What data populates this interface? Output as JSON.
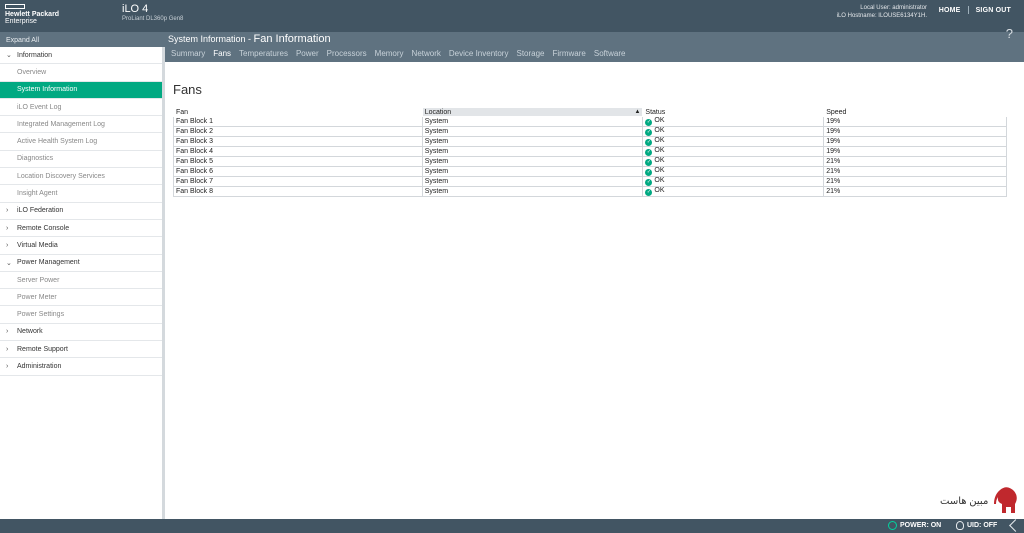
{
  "header": {
    "brand_line1": "Hewlett Packard",
    "brand_line2": "Enterprise",
    "product_name": "iLO 4",
    "product_model": "ProLiant DL360p Gen8",
    "local_user": "Local User: administrator",
    "hostname": "iLO Hostname: ILOUSE6134Y1H.",
    "home_label": "HOME",
    "signout_label": "SIGN OUT"
  },
  "subheader": {
    "expand_all": "Expand All",
    "section": "System Information",
    "separator": " - ",
    "page": "Fan Information",
    "help": "?"
  },
  "tabs": [
    "Summary",
    "Fans",
    "Temperatures",
    "Power",
    "Processors",
    "Memory",
    "Network",
    "Device Inventory",
    "Storage",
    "Firmware",
    "Software"
  ],
  "active_tab": "Fans",
  "sidebar": {
    "items": [
      {
        "label": "Information",
        "type": "section",
        "expanded": true
      },
      {
        "label": "Overview",
        "type": "child"
      },
      {
        "label": "System Information",
        "type": "child",
        "active": true
      },
      {
        "label": "iLO Event Log",
        "type": "child"
      },
      {
        "label": "Integrated Management Log",
        "type": "child"
      },
      {
        "label": "Active Health System Log",
        "type": "child"
      },
      {
        "label": "Diagnostics",
        "type": "child"
      },
      {
        "label": "Location Discovery Services",
        "type": "child"
      },
      {
        "label": "Insight Agent",
        "type": "child"
      },
      {
        "label": "iLO Federation",
        "type": "section",
        "expanded": false
      },
      {
        "label": "Remote Console",
        "type": "section",
        "expanded": false
      },
      {
        "label": "Virtual Media",
        "type": "section",
        "expanded": false
      },
      {
        "label": "Power Management",
        "type": "section",
        "expanded": true
      },
      {
        "label": "Server Power",
        "type": "child"
      },
      {
        "label": "Power Meter",
        "type": "child"
      },
      {
        "label": "Power Settings",
        "type": "child"
      },
      {
        "label": "Network",
        "type": "section",
        "expanded": false
      },
      {
        "label": "Remote Support",
        "type": "section",
        "expanded": false
      },
      {
        "label": "Administration",
        "type": "section",
        "expanded": false
      }
    ]
  },
  "content": {
    "title": "Fans",
    "columns": [
      "Fan",
      "Location",
      "Status",
      "Speed"
    ],
    "sorted_column": "Location",
    "rows": [
      {
        "fan": "Fan Block 1",
        "location": "System",
        "status": "OK",
        "speed": "19%"
      },
      {
        "fan": "Fan Block 2",
        "location": "System",
        "status": "OK",
        "speed": "19%"
      },
      {
        "fan": "Fan Block 3",
        "location": "System",
        "status": "OK",
        "speed": "19%"
      },
      {
        "fan": "Fan Block 4",
        "location": "System",
        "status": "OK",
        "speed": "19%"
      },
      {
        "fan": "Fan Block 5",
        "location": "System",
        "status": "OK",
        "speed": "21%"
      },
      {
        "fan": "Fan Block 6",
        "location": "System",
        "status": "OK",
        "speed": "21%"
      },
      {
        "fan": "Fan Block 7",
        "location": "System",
        "status": "OK",
        "speed": "21%"
      },
      {
        "fan": "Fan Block 8",
        "location": "System",
        "status": "OK",
        "speed": "21%"
      }
    ]
  },
  "footer": {
    "power": "POWER: ON",
    "uid": "UID: OFF"
  },
  "watermark": {
    "text": "مبین هاست"
  },
  "colors": {
    "header_bg": "#425563",
    "subheader_bg": "#5f7280",
    "accent": "#01a982"
  },
  "icons": {
    "status_ok": "check-circle-icon",
    "power": "power-icon",
    "uid": "bulb-icon",
    "expand": "resize-icon"
  }
}
